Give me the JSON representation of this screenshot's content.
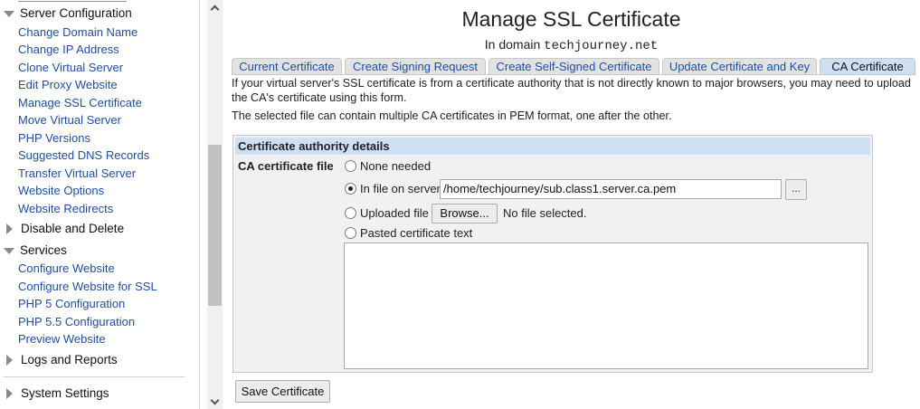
{
  "sidebar": {
    "sections": [
      {
        "label": "Server Configuration",
        "expanded": true,
        "items": [
          "Change Domain Name",
          "Change IP Address",
          "Clone Virtual Server",
          "Edit Proxy Website",
          "Manage SSL Certificate",
          "Move Virtual Server",
          "PHP Versions",
          "Suggested DNS Records",
          "Transfer Virtual Server",
          "Website Options",
          "Website Redirects"
        ]
      },
      {
        "label": "Disable and Delete",
        "expanded": false,
        "items": []
      },
      {
        "label": "Services",
        "expanded": true,
        "items": [
          "Configure Website",
          "Configure Website for SSL",
          "PHP 5 Configuration",
          "PHP 5.5 Configuration",
          "Preview Website"
        ]
      },
      {
        "label": "Logs and Reports",
        "expanded": false,
        "items": []
      },
      {
        "label": "System Settings",
        "expanded": false,
        "items": []
      }
    ]
  },
  "page": {
    "title": "Manage SSL Certificate",
    "subtitle_prefix": "In domain",
    "domain": "techjourney.net"
  },
  "tabs": [
    "Current Certificate",
    "Create Signing Request",
    "Create Self-Signed Certificate",
    "Update Certificate and Key",
    "CA Certificate"
  ],
  "active_tab": "CA Certificate",
  "description": {
    "line1": "If your virtual server's SSL certificate is from a certificate authority that is not directly known to major browsers, you may need to upload the CA's certificate using this form.",
    "line2": "The selected file can contain multiple CA certificates in PEM format, one after the other."
  },
  "form": {
    "header": "Certificate authority details",
    "field_label": "CA certificate file",
    "options": {
      "none": "None needed",
      "server": "In file on server",
      "uploaded": "Uploaded file",
      "pasted": "Pasted certificate text"
    },
    "selected_option": "server",
    "server_path": "/home/techjourney/sub.class1.server.ca.pem",
    "chooser_label": "...",
    "browse_label": "Browse...",
    "no_file_text": "No file selected.",
    "pasted_text": ""
  },
  "actions": {
    "save_label": "Save Certificate"
  },
  "colors": {
    "link": "#1f4fa0",
    "tab_active_bg": "#cfe0f4",
    "header_bg": "#cfe0f4"
  }
}
